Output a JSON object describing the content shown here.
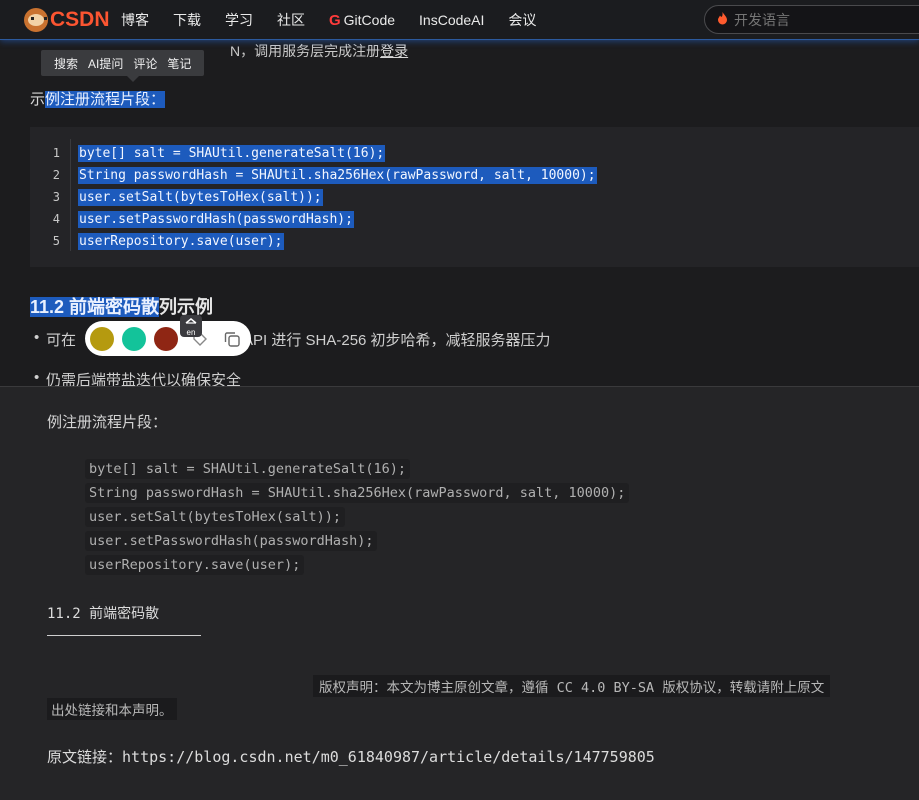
{
  "nav": {
    "logo_text": "CSDN",
    "items": [
      "博客",
      "下载",
      "学习",
      "社区",
      "GitCode",
      "InsCodeAI",
      "会议"
    ],
    "gitcode_mark": "G",
    "search_placeholder": "开发语言"
  },
  "selection_toolbar": [
    "搜索",
    "AI提问",
    "评论",
    "笔记"
  ],
  "article": {
    "partial_line_text": "N，调用服务层完成注册",
    "partial_line_link": "登录",
    "intro_prefix": "示",
    "intro_selected": "例注册流程片段：",
    "code_lines": [
      {
        "n": "1",
        "text": "byte[] salt = SHAUtil.generateSalt(16);"
      },
      {
        "n": "2",
        "text": "String passwordHash = SHAUtil.sha256Hex(rawPassword, salt, 10000);"
      },
      {
        "n": "3",
        "text": "user.setSalt(bytesToHex(salt));"
      },
      {
        "n": "4",
        "text": "user.setPasswordHash(passwordHash);"
      },
      {
        "n": "5",
        "text": "userRepository.save(user);"
      }
    ],
    "heading_selected": "11.2 前端密码散",
    "heading_rest": "列示例",
    "bullet1_start": "可在",
    "bullet1_end": "API 进行 SHA-256 初步哈希，减轻服务器压力",
    "bullet2": "仍需后端带盐迭代以确保安全",
    "highlight_colors": [
      "#b59a0f",
      "#13c39a",
      "#8f2614"
    ],
    "translate_label": "en"
  },
  "preview": {
    "intro": "例注册流程片段：",
    "code_lines": [
      "byte[] salt = SHAUtil.generateSalt(16);",
      "String passwordHash = SHAUtil.sha256Hex(rawPassword, salt, 10000);",
      "user.setSalt(bytesToHex(salt));",
      "user.setPasswordHash(passwordHash);",
      "userRepository.save(user);"
    ],
    "heading": "11.2 前端密码散",
    "copyright_line1": "版权声明：本文为博主原创文章，遵循 CC 4.0 BY-SA 版权协议，转载请附上原文",
    "copyright_line2": "出处链接和本声明。",
    "link_label": "原文链接：",
    "link_url": "https://blog.csdn.net/m0_61840987/article/details/147759805"
  }
}
